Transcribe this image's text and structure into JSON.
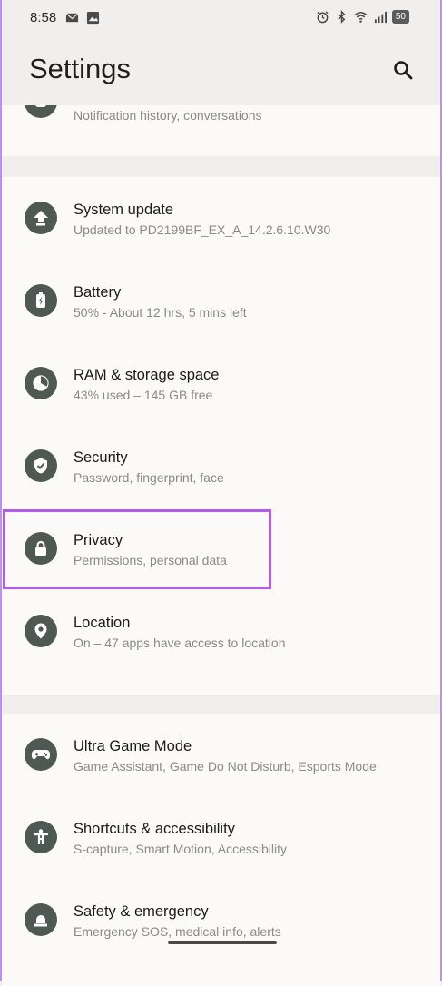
{
  "status_bar": {
    "time": "8:58",
    "battery": "50",
    "left_icons": [
      "mail-icon",
      "image-icon"
    ],
    "right_icons": [
      "alarm-icon",
      "bluetooth-icon",
      "wifi-icon",
      "signal-icon"
    ]
  },
  "app_bar": {
    "title": "Settings",
    "search_icon": "search-icon"
  },
  "partial_item": {
    "subtitle": "Notification history, conversations",
    "icon": "notifications-icon"
  },
  "groups": [
    {
      "items": [
        {
          "title": "System update",
          "subtitle": "Updated to PD2199BF_EX_A_14.2.6.10.W30",
          "icon": "system-update-icon"
        },
        {
          "title": "Battery",
          "subtitle": "50% - About 12 hrs, 5 mins left",
          "icon": "battery-icon"
        },
        {
          "title": "RAM & storage space",
          "subtitle": "43% used – 145 GB free",
          "icon": "storage-pie-icon"
        },
        {
          "title": "Security",
          "subtitle": "Password, fingerprint, face",
          "icon": "shield-icon"
        },
        {
          "title": "Privacy",
          "subtitle": "Permissions, personal data",
          "icon": "lock-icon"
        },
        {
          "title": "Location",
          "subtitle": "On – 47 apps have access to location",
          "icon": "location-pin-icon"
        }
      ]
    },
    {
      "items": [
        {
          "title": "Ultra Game Mode",
          "subtitle": "Game Assistant, Game Do Not Disturb, Esports Mode",
          "icon": "gamepad-icon"
        },
        {
          "title": "Shortcuts & accessibility",
          "subtitle": "S-capture, Smart Motion, Accessibility",
          "icon": "accessibility-icon"
        },
        {
          "title": "Safety & emergency",
          "subtitle": "Emergency SOS, medical info, alerts",
          "icon": "emergency-icon"
        }
      ]
    }
  ],
  "colors": {
    "icon_circle": "#4e5954",
    "highlight": "#b45ce8",
    "background": "#f0efee",
    "card": "#fbfaf9"
  }
}
